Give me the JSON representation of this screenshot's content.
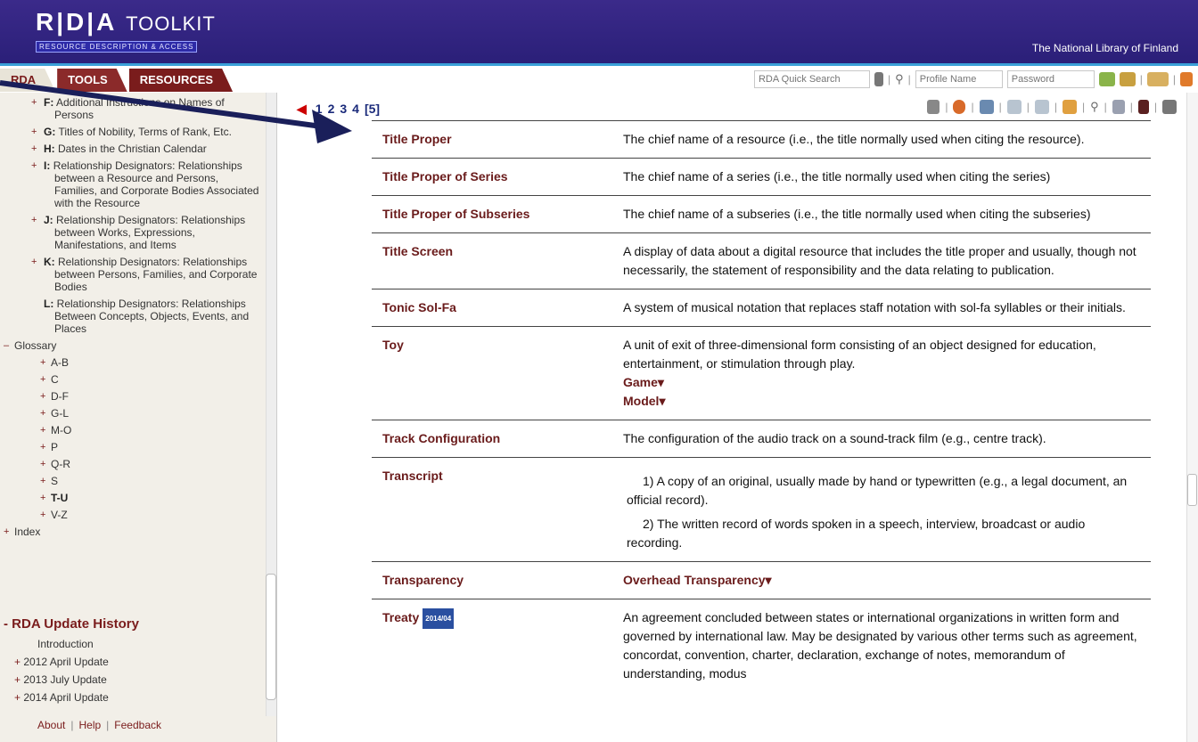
{
  "header": {
    "logo_main": "R|D|A",
    "logo_tool": "TOOLKIT",
    "logo_sub": "RESOURCE DESCRIPTION & ACCESS",
    "institution": "The National Library of Finland"
  },
  "tabs": [
    {
      "label": "RDA"
    },
    {
      "label": "TOOLS"
    },
    {
      "label": "RESOURCES"
    }
  ],
  "topbar": {
    "quick_search_placeholder": "RDA Quick Search",
    "profile_placeholder": "Profile Name",
    "password_placeholder": "Password"
  },
  "sidebar": {
    "items": [
      {
        "key": "F:",
        "text": "Additional Instructions on Names of Persons"
      },
      {
        "key": "G:",
        "text": "Titles of Nobility, Terms of Rank, Etc."
      },
      {
        "key": "H:",
        "text": "Dates in the Christian Calendar"
      },
      {
        "key": "I:",
        "text": "Relationship Designators: Relationships between a Resource and Persons, Families, and Corporate Bodies Associated with the Resource"
      },
      {
        "key": "J:",
        "text": "Relationship Designators: Relationships between Works, Expressions, Manifestations, and Items"
      },
      {
        "key": "K:",
        "text": "Relationship Designators: Relationships between Persons, Families, and Corporate Bodies"
      },
      {
        "key": "L:",
        "text": "Relationship Designators: Relationships Between Concepts, Objects, Events, and Places"
      }
    ],
    "glossary_label": "Glossary",
    "glossary_items": [
      "A-B",
      "C",
      "D-F",
      "G-L",
      "M-O",
      "P",
      "Q-R",
      "S",
      "T-U",
      "V-Z"
    ],
    "index_label": "Index",
    "update_history_label": "RDA Update History",
    "updates": [
      "Introduction",
      "2012 April Update",
      "2013 July Update",
      "2014 April Update"
    ],
    "footer": {
      "about": "About",
      "help": "Help",
      "feedback": "Feedback"
    }
  },
  "pager": {
    "pages": [
      "1",
      "2",
      "3",
      "4",
      "[5]"
    ]
  },
  "glossary": [
    {
      "term": "Title Proper",
      "def": "The chief name of a resource (i.e., the title normally used when citing the resource)."
    },
    {
      "term": "Title Proper of Series",
      "def": "The chief name of a series (i.e., the title normally used when citing the series)"
    },
    {
      "term": "Title Proper of Subseries",
      "def": "The chief name of a subseries (i.e., the title normally used when citing the subseries)"
    },
    {
      "term": "Title Screen",
      "def": "A display of data about a digital resource that includes the title proper and usually, though not necessarily, the statement of responsibility and the data relating to publication."
    },
    {
      "term": "Tonic Sol-Fa",
      "def": "A system of musical notation that replaces staff notation with sol-fa syllables or their initials."
    },
    {
      "term": "Toy",
      "def": "A unit of exit of three-dimensional form consisting of an object designed for education, entertainment, or stimulation through play.",
      "see": [
        "Game▾",
        "Model▾"
      ]
    },
    {
      "term": "Track Configuration",
      "def": "The configuration of the audio track on a sound-track film (e.g., centre track)."
    },
    {
      "term": "Transcript",
      "def1": "1) A copy of an original, usually made by hand or typewritten (e.g., a legal document, an official record).",
      "def2": "2) The written record of words spoken in a speech, interview, broadcast or audio recording."
    },
    {
      "term": "Transparency",
      "see_only": "Overhead Transparency▾"
    },
    {
      "term": "Treaty",
      "badge": "2014/04",
      "def": "An agreement concluded between states or international organizations in written form and governed by international law. May be designated by various other terms such as agreement, concordat, convention, charter, declaration, exchange of notes, memorandum of understanding, modus"
    }
  ]
}
